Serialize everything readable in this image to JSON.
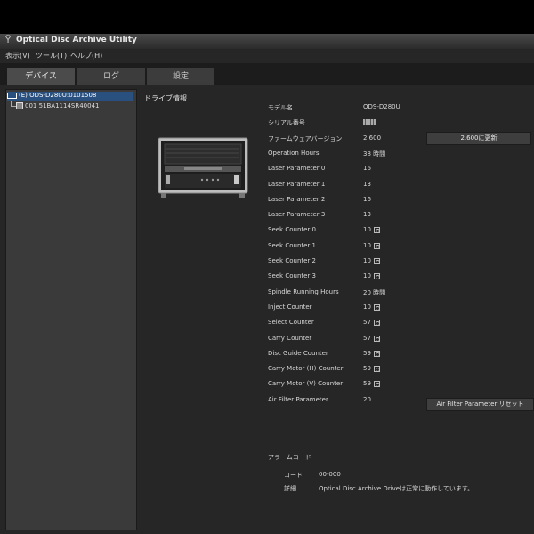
{
  "window": {
    "title": "Optical Disc Archive Utility",
    "icon": "antenna-icon"
  },
  "menu": {
    "items": [
      "表示(V)",
      "ツール(T)",
      "ヘルプ(H)"
    ]
  },
  "tabs": [
    {
      "label": "デバイス",
      "active": true
    },
    {
      "label": "ログ",
      "active": false
    },
    {
      "label": "設定",
      "active": false
    }
  ],
  "tree": {
    "root": {
      "label": "(E) ODS-D280U:0101508",
      "icon": "drive-icon",
      "selected": true
    },
    "child": {
      "label": "001 51BA1114SR40041",
      "icon": "disc-cartridge-icon"
    }
  },
  "drive_info": {
    "section_title": "ドライブ情報",
    "properties": [
      {
        "label": "モデル名",
        "value": "ODS-D280U"
      },
      {
        "label": "シリアル番号",
        "value": ""
      },
      {
        "label": "ファームウェアバージョン",
        "value": "2.600"
      },
      {
        "label": "Operation Hours",
        "value": "38 時間"
      },
      {
        "label": "Laser Parameter 0",
        "value": "16"
      },
      {
        "label": "Laser Parameter 1",
        "value": "13"
      },
      {
        "label": "Laser Parameter 2",
        "value": "16"
      },
      {
        "label": "Laser Parameter 3",
        "value": "13"
      },
      {
        "label": "Seek Counter 0",
        "value": "10",
        "unit_icon": "counter-unit-icon"
      },
      {
        "label": "Seek Counter 1",
        "value": "10",
        "unit_icon": "counter-unit-icon"
      },
      {
        "label": "Seek Counter 2",
        "value": "10",
        "unit_icon": "counter-unit-icon"
      },
      {
        "label": "Seek Counter 3",
        "value": "10",
        "unit_icon": "counter-unit-icon"
      },
      {
        "label": "Spindle Running Hours",
        "value": "20 時間"
      },
      {
        "label": "Inject Counter",
        "value": "10",
        "unit_icon": "counter-unit-icon"
      },
      {
        "label": "Select Counter",
        "value": "57",
        "unit_icon": "counter-unit-icon"
      },
      {
        "label": "Carry Counter",
        "value": "57",
        "unit_icon": "counter-unit-icon"
      },
      {
        "label": "Disc Guide Counter",
        "value": "59",
        "unit_icon": "counter-unit-icon"
      },
      {
        "label": "Carry Motor (H) Counter",
        "value": "59",
        "unit_icon": "counter-unit-icon"
      },
      {
        "label": "Carry Motor (V) Counter",
        "value": "59",
        "unit_icon": "counter-unit-icon"
      },
      {
        "label": "Air Filter Parameter",
        "value": "20"
      }
    ],
    "update_button": "2.600に更新",
    "air_filter_reset_button": "Air Filter Parameter リセット"
  },
  "alarm": {
    "title": "アラームコード",
    "code_label": "コード",
    "code_value": "00-000",
    "detail_label": "詳細",
    "detail_value": "Optical Disc Archive Driveは正常に動作しています。"
  }
}
